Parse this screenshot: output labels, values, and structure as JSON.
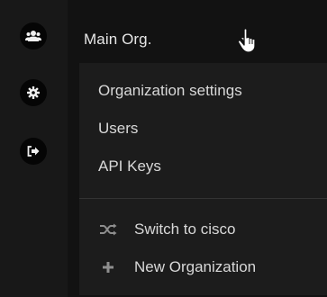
{
  "org": {
    "name": "Main Org."
  },
  "sidebar": {
    "items": [
      {
        "icon": "users-icon"
      },
      {
        "icon": "gear-icon"
      },
      {
        "icon": "sign-out-icon"
      }
    ]
  },
  "dropdown": {
    "items": [
      {
        "label": "Organization settings"
      },
      {
        "label": "Users"
      },
      {
        "label": "API Keys"
      }
    ],
    "actions": [
      {
        "icon": "shuffle-icon",
        "label": "Switch to cisco"
      },
      {
        "icon": "plus-icon",
        "label": "New Organization"
      }
    ]
  },
  "colors": {
    "background": "#121212",
    "menu": "#1c1c1c",
    "text": "#d8d8d8"
  }
}
